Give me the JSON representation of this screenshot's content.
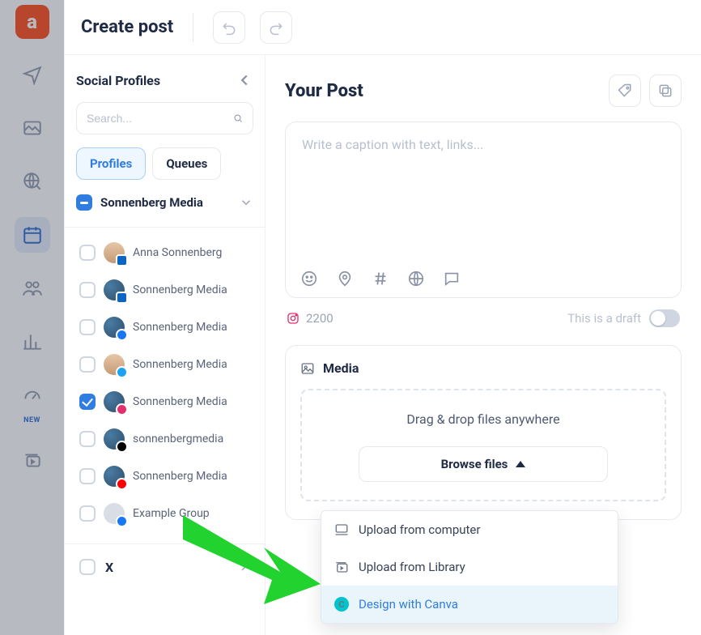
{
  "topbar": {
    "title": "Create post"
  },
  "sidebar": {
    "title": "Social Profiles",
    "search_placeholder": "Search...",
    "tabs": {
      "profiles": "Profiles",
      "queues": "Queues"
    },
    "group_name": "Sonnenberg Media",
    "profiles": [
      {
        "name": "Anna Sonnenberg",
        "network": "linkedin",
        "checked": false,
        "avatar": "person"
      },
      {
        "name": "Sonnenberg Media",
        "network": "linkedin",
        "checked": false,
        "avatar": "globe"
      },
      {
        "name": "Sonnenberg Media",
        "network": "facebook",
        "checked": false,
        "avatar": "globe"
      },
      {
        "name": "Sonnenberg Media",
        "network": "twitter",
        "checked": false,
        "avatar": "person"
      },
      {
        "name": "Sonnenberg Media",
        "network": "instagram",
        "checked": true,
        "avatar": "globe"
      },
      {
        "name": "sonnenbergmedia",
        "network": "tiktok",
        "checked": false,
        "avatar": "globe"
      },
      {
        "name": "Sonnenberg Media",
        "network": "youtube",
        "checked": false,
        "avatar": "globe"
      },
      {
        "name": "Example Group",
        "network": "facebook",
        "checked": false,
        "avatar": "grey"
      }
    ],
    "footer": {
      "x_label": "X"
    }
  },
  "editor": {
    "title": "Your Post",
    "caption_placeholder": "Write a caption with text, links...",
    "char_count": "2200",
    "draft_label": "This is a draft",
    "media_label": "Media",
    "dropzone": "Drag & drop files anywhere",
    "browse": "Browse files"
  },
  "menu": {
    "upload_computer": "Upload from computer",
    "upload_library": "Upload from Library",
    "design_canva": "Design with Canva"
  },
  "nav": {
    "new_label": "NEW"
  }
}
